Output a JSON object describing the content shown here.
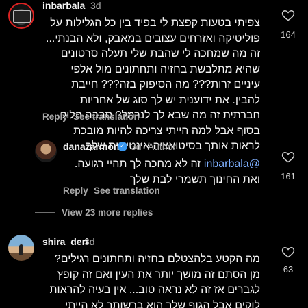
{
  "comments": [
    {
      "username": "inbarbala",
      "time": "3d",
      "text": "צפיתי בטעות קפצת לי בפיד בין כל הגלילות על פוליטיקה ואזרחים עצובים במאבק, ולא הבנתי... זה מה שמחכה לי שהבת שלי תעלה סרטונים שהיא מתלבשת בחזיה ותחתונים מול אלפי עיניים זרות??? מה הסיפוק בזה??? חייבת להבין. את ידוענית יש לך סוג של אחריות חברתית זה מה שבא לך לנרמל? סבבה הלוק בסוף אבל למה הייתי צריכה להיות מובכת לראות אותך בסיטואציה אינטימית שלך.",
      "reply_label": "Reply",
      "translation_label": "See translation",
      "likes": "164"
    },
    {
      "username": "danazarmon",
      "time": "3d",
      "author_tag": "· Author",
      "mention": "@inbarbala",
      "text": "זה לא מחכה לך תהיי רגועה. ואת החינוך תשמרי לבת שלך",
      "reply_label": "Reply",
      "translation_label": "See translation",
      "likes": "161"
    },
    {
      "username": "shira_deri",
      "time": "3d",
      "text": "מה הקטע בלהצטלם בחזיה ותחתונים רגילים? מן הסתם זה מושך יותר את העין ואם זה קופץ לגברים אז זה לא נראה טוב... אין בעיה להראות לוקים אבל הגוף שלך הוא ברשותך לא הייתי מפרסמת את עצמי עם לבנבנים...",
      "likes": "63"
    }
  ],
  "view_replies": "View 23 more replies",
  "icons": {
    "like": "heart-outline-icon",
    "verified": "verified-badge-icon"
  },
  "colors": {
    "background": "#000000",
    "verified": "#3897f0",
    "mention": "#7fb0ff",
    "muted": "#a8a8a8"
  }
}
